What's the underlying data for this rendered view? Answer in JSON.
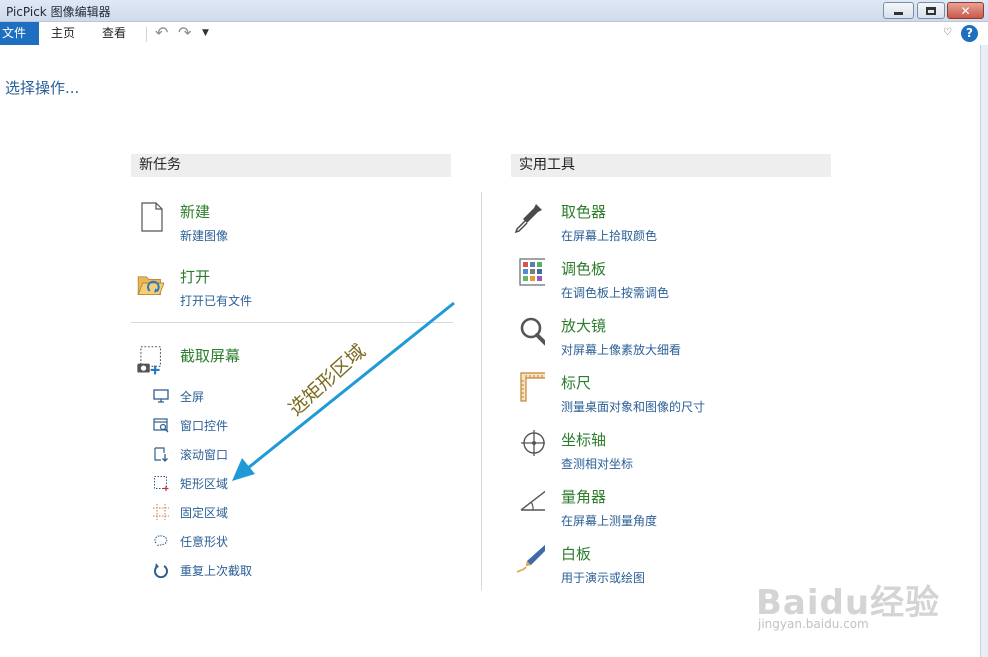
{
  "window": {
    "title": "PicPick 图像编辑器"
  },
  "menu": {
    "file": "文件",
    "home": "主页",
    "view": "查看"
  },
  "prompt": "选择操作...",
  "new_task": {
    "header": "新任务",
    "items": [
      {
        "title": "新建",
        "subtitle": "新建图像",
        "icon": "new-file-icon"
      },
      {
        "title": "打开",
        "subtitle": "打开已有文件",
        "icon": "open-folder-icon"
      }
    ],
    "capture": {
      "title": "截取屏幕",
      "icon": "screen-capture-icon",
      "items": [
        {
          "label": "全屏",
          "icon": "monitor-icon"
        },
        {
          "label": "窗口控件",
          "icon": "window-control-icon"
        },
        {
          "label": "滚动窗口",
          "icon": "scroll-window-icon"
        },
        {
          "label": "矩形区域",
          "icon": "rectangle-region-icon"
        },
        {
          "label": "固定区域",
          "icon": "fixed-region-icon"
        },
        {
          "label": "任意形状",
          "icon": "freehand-shape-icon"
        },
        {
          "label": "重复上次截取",
          "icon": "repeat-capture-icon"
        }
      ]
    }
  },
  "tools": {
    "header": "实用工具",
    "items": [
      {
        "title": "取色器",
        "subtitle": "在屏幕上拾取颜色",
        "icon": "color-picker-icon"
      },
      {
        "title": "调色板",
        "subtitle": "在调色板上按需调色",
        "icon": "palette-icon"
      },
      {
        "title": "放大镜",
        "subtitle": "对屏幕上像素放大细看",
        "icon": "magnifier-icon"
      },
      {
        "title": "标尺",
        "subtitle": "测量桌面对象和图像的尺寸",
        "icon": "ruler-icon"
      },
      {
        "title": "坐标轴",
        "subtitle": "查测相对坐标",
        "icon": "crosshair-icon"
      },
      {
        "title": "量角器",
        "subtitle": "在屏幕上测量角度",
        "icon": "protractor-icon"
      },
      {
        "title": "白板",
        "subtitle": "用于演示或绘图",
        "icon": "whiteboard-pen-icon"
      }
    ]
  },
  "annotation": {
    "text": "选矩形区域",
    "color": "#7b6a1f",
    "arrow_color": "#1e9bd7"
  },
  "watermark": {
    "brand": "Bai",
    "brand2": "du",
    "brand3": "经验",
    "url": "jingyan.baidu.com"
  },
  "colors": {
    "accent": "#1f6fc1",
    "title_green": "#2d7d2d",
    "link_blue": "#2b5f97"
  }
}
